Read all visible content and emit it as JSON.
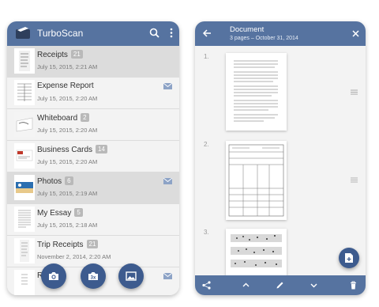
{
  "colors": {
    "primary": "#5673a0",
    "fab": "#3d5b8e",
    "list_bg": "#f3f3f3",
    "selected_row": "#dcdcdc"
  },
  "left": {
    "app_title": "TurboScan",
    "icons": [
      "logo-icon",
      "search-icon",
      "more-vert-icon"
    ],
    "items": [
      {
        "name": "Receipts",
        "count": "21",
        "date": "July 15, 2015, 2:21 AM",
        "mail": false,
        "selected": true
      },
      {
        "name": "Expense Report",
        "count": "",
        "date": "July 15, 2015, 2:20 AM",
        "mail": true,
        "selected": false
      },
      {
        "name": "Whiteboard",
        "count": "2",
        "date": "July 15, 2015, 2:20 AM",
        "mail": false,
        "selected": false
      },
      {
        "name": "Business Cards",
        "count": "14",
        "date": "July 15, 2015, 2:20 AM",
        "mail": false,
        "selected": false
      },
      {
        "name": "Photos",
        "count": "6",
        "date": "July 15, 2015, 2:19 AM",
        "mail": true,
        "selected": true
      },
      {
        "name": "My Essay",
        "count": "5",
        "date": "July 15, 2015, 2:18 AM",
        "mail": false,
        "selected": false
      },
      {
        "name": "Trip Receipts",
        "count": "21",
        "date": "November 2, 2014, 2:20 AM",
        "mail": false,
        "selected": false
      },
      {
        "name": "R",
        "count": "",
        "date": "",
        "mail": true,
        "selected": false
      }
    ],
    "fabs": [
      {
        "icon": "camera-icon",
        "label": ""
      },
      {
        "icon": "burst-camera-icon",
        "label": "3x"
      },
      {
        "icon": "gallery-icon",
        "label": ""
      }
    ]
  },
  "right": {
    "doc_title": "Document",
    "doc_subtitle": "3 pages – October 31, 2014",
    "pages": [
      "1.",
      "2.",
      "3."
    ],
    "bottom_icons": [
      "share-icon",
      "chevron-up-icon",
      "edit-icon",
      "chevron-down-icon",
      "delete-icon"
    ],
    "fab_icon": "new-document-icon"
  }
}
